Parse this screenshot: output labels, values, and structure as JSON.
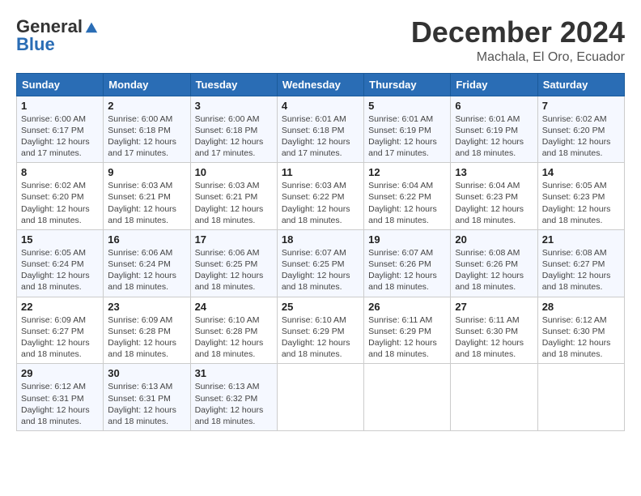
{
  "logo": {
    "general": "General",
    "blue": "Blue"
  },
  "title": "December 2024",
  "location": "Machala, El Oro, Ecuador",
  "days_of_week": [
    "Sunday",
    "Monday",
    "Tuesday",
    "Wednesday",
    "Thursday",
    "Friday",
    "Saturday"
  ],
  "weeks": [
    [
      {
        "day": "1",
        "sunrise": "6:00 AM",
        "sunset": "6:17 PM",
        "daylight": "12 hours and 17 minutes."
      },
      {
        "day": "2",
        "sunrise": "6:00 AM",
        "sunset": "6:18 PM",
        "daylight": "12 hours and 17 minutes."
      },
      {
        "day": "3",
        "sunrise": "6:00 AM",
        "sunset": "6:18 PM",
        "daylight": "12 hours and 17 minutes."
      },
      {
        "day": "4",
        "sunrise": "6:01 AM",
        "sunset": "6:18 PM",
        "daylight": "12 hours and 17 minutes."
      },
      {
        "day": "5",
        "sunrise": "6:01 AM",
        "sunset": "6:19 PM",
        "daylight": "12 hours and 17 minutes."
      },
      {
        "day": "6",
        "sunrise": "6:01 AM",
        "sunset": "6:19 PM",
        "daylight": "12 hours and 18 minutes."
      },
      {
        "day": "7",
        "sunrise": "6:02 AM",
        "sunset": "6:20 PM",
        "daylight": "12 hours and 18 minutes."
      }
    ],
    [
      {
        "day": "8",
        "sunrise": "6:02 AM",
        "sunset": "6:20 PM",
        "daylight": "12 hours and 18 minutes."
      },
      {
        "day": "9",
        "sunrise": "6:03 AM",
        "sunset": "6:21 PM",
        "daylight": "12 hours and 18 minutes."
      },
      {
        "day": "10",
        "sunrise": "6:03 AM",
        "sunset": "6:21 PM",
        "daylight": "12 hours and 18 minutes."
      },
      {
        "day": "11",
        "sunrise": "6:03 AM",
        "sunset": "6:22 PM",
        "daylight": "12 hours and 18 minutes."
      },
      {
        "day": "12",
        "sunrise": "6:04 AM",
        "sunset": "6:22 PM",
        "daylight": "12 hours and 18 minutes."
      },
      {
        "day": "13",
        "sunrise": "6:04 AM",
        "sunset": "6:23 PM",
        "daylight": "12 hours and 18 minutes."
      },
      {
        "day": "14",
        "sunrise": "6:05 AM",
        "sunset": "6:23 PM",
        "daylight": "12 hours and 18 minutes."
      }
    ],
    [
      {
        "day": "15",
        "sunrise": "6:05 AM",
        "sunset": "6:24 PM",
        "daylight": "12 hours and 18 minutes."
      },
      {
        "day": "16",
        "sunrise": "6:06 AM",
        "sunset": "6:24 PM",
        "daylight": "12 hours and 18 minutes."
      },
      {
        "day": "17",
        "sunrise": "6:06 AM",
        "sunset": "6:25 PM",
        "daylight": "12 hours and 18 minutes."
      },
      {
        "day": "18",
        "sunrise": "6:07 AM",
        "sunset": "6:25 PM",
        "daylight": "12 hours and 18 minutes."
      },
      {
        "day": "19",
        "sunrise": "6:07 AM",
        "sunset": "6:26 PM",
        "daylight": "12 hours and 18 minutes."
      },
      {
        "day": "20",
        "sunrise": "6:08 AM",
        "sunset": "6:26 PM",
        "daylight": "12 hours and 18 minutes."
      },
      {
        "day": "21",
        "sunrise": "6:08 AM",
        "sunset": "6:27 PM",
        "daylight": "12 hours and 18 minutes."
      }
    ],
    [
      {
        "day": "22",
        "sunrise": "6:09 AM",
        "sunset": "6:27 PM",
        "daylight": "12 hours and 18 minutes."
      },
      {
        "day": "23",
        "sunrise": "6:09 AM",
        "sunset": "6:28 PM",
        "daylight": "12 hours and 18 minutes."
      },
      {
        "day": "24",
        "sunrise": "6:10 AM",
        "sunset": "6:28 PM",
        "daylight": "12 hours and 18 minutes."
      },
      {
        "day": "25",
        "sunrise": "6:10 AM",
        "sunset": "6:29 PM",
        "daylight": "12 hours and 18 minutes."
      },
      {
        "day": "26",
        "sunrise": "6:11 AM",
        "sunset": "6:29 PM",
        "daylight": "12 hours and 18 minutes."
      },
      {
        "day": "27",
        "sunrise": "6:11 AM",
        "sunset": "6:30 PM",
        "daylight": "12 hours and 18 minutes."
      },
      {
        "day": "28",
        "sunrise": "6:12 AM",
        "sunset": "6:30 PM",
        "daylight": "12 hours and 18 minutes."
      }
    ],
    [
      {
        "day": "29",
        "sunrise": "6:12 AM",
        "sunset": "6:31 PM",
        "daylight": "12 hours and 18 minutes."
      },
      {
        "day": "30",
        "sunrise": "6:13 AM",
        "sunset": "6:31 PM",
        "daylight": "12 hours and 18 minutes."
      },
      {
        "day": "31",
        "sunrise": "6:13 AM",
        "sunset": "6:32 PM",
        "daylight": "12 hours and 18 minutes."
      },
      null,
      null,
      null,
      null
    ]
  ]
}
